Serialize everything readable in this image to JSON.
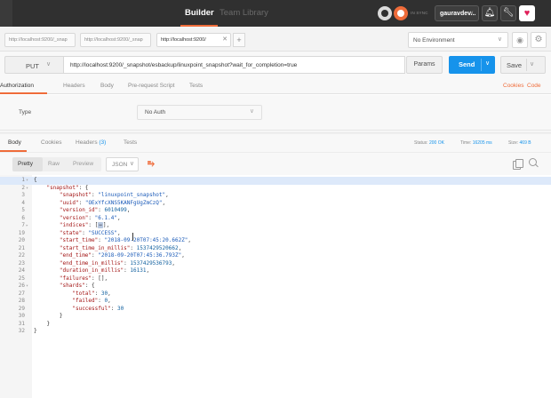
{
  "topbar": {
    "builder_label": "Builder",
    "team_label": "Team Library",
    "sync_label": "IN SYNC",
    "user_label": "gauravdev...",
    "accent": "#ef6c3a"
  },
  "request_tabs": [
    {
      "label": "http://localhost:9200/_snap"
    },
    {
      "label": "http://localhost:9200/_snap"
    },
    {
      "label": "http://localhost:9200/"
    }
  ],
  "environment": {
    "selected": "No Environment"
  },
  "request": {
    "method": "PUT",
    "url": "http://localhost:9200/_snapshot/esbackup/linuxpoint_snapshot?wait_for_completion=true",
    "params_label": "Params",
    "send_label": "Send",
    "save_label": "Save",
    "send_color": "#1693eb"
  },
  "request_subtabs": {
    "items": [
      "Authorization",
      "Headers",
      "Body",
      "Pre-request Script",
      "Tests"
    ],
    "active": "Authorization",
    "links": [
      "Cookies",
      "Code"
    ]
  },
  "auth": {
    "type_label": "Type",
    "type_value": "No Auth"
  },
  "response_tabs": {
    "body": "Body",
    "cookies": "Cookies",
    "headers": "Headers",
    "headers_count": "(3)",
    "tests": "Tests"
  },
  "response_status": {
    "status_label": "Status:",
    "status_value": "200 OK",
    "time_label": "Time:",
    "time_value": "16205 ms",
    "size_label": "Size:",
    "size_value": "469 B"
  },
  "view_options": {
    "pretty": "Pretty",
    "raw": "Raw",
    "preview": "Preview",
    "format": "JSON"
  },
  "code_lines": [
    {
      "n": "1",
      "fold": "▾",
      "html": "{"
    },
    {
      "n": "2",
      "fold": "▾",
      "html": "    <span class='k'>\"snapshot\"</span>: {"
    },
    {
      "n": "3",
      "fold": "",
      "html": "        <span class='k'>\"snapshot\"</span>: <span class='s'>\"linuxpoint_snapshot\"</span>,"
    },
    {
      "n": "4",
      "fold": "",
      "html": "        <span class='k'>\"uuid\"</span>: <span class='s'>\"OExYfcXNS5KANFgUgZmCzQ\"</span>,"
    },
    {
      "n": "5",
      "fold": "",
      "html": "        <span class='k'>\"version_id\"</span>: <span class='n'>6010499</span>,"
    },
    {
      "n": "6",
      "fold": "",
      "html": "        <span class='k'>\"version\"</span>: <span class='s'>\"6.1.4\"</span>,"
    },
    {
      "n": "7",
      "fold": "▸",
      "html": "        <span class='k'>\"indices\"</span>: [<span class='fold-marker'>↔</span>],"
    },
    {
      "n": "19",
      "fold": "",
      "html": "        <span class='k'>\"state\"</span>: <span class='s'>\"SUCCESS\"</span>,"
    },
    {
      "n": "20",
      "fold": "",
      "html": "        <span class='k'>\"start_time\"</span>: <span class='s'>\"2018-09-20T07:45:20.662Z\"</span>,"
    },
    {
      "n": "21",
      "fold": "",
      "html": "        <span class='k'>\"start_time_in_millis\"</span>: <span class='n'>1537429520662</span>,"
    },
    {
      "n": "22",
      "fold": "",
      "html": "        <span class='k'>\"end_time\"</span>: <span class='s'>\"2018-09-20T07:45:36.793Z\"</span>,"
    },
    {
      "n": "23",
      "fold": "",
      "html": "        <span class='k'>\"end_time_in_millis\"</span>: <span class='n'>1537429536793</span>,"
    },
    {
      "n": "24",
      "fold": "",
      "html": "        <span class='k'>\"duration_in_millis\"</span>: <span class='n'>16131</span>,"
    },
    {
      "n": "25",
      "fold": "",
      "html": "        <span class='k'>\"failures\"</span>: [],"
    },
    {
      "n": "26",
      "fold": "▾",
      "html": "        <span class='k'>\"shards\"</span>: {"
    },
    {
      "n": "27",
      "fold": "",
      "html": "            <span class='k'>\"total\"</span>: <span class='n'>30</span>,"
    },
    {
      "n": "28",
      "fold": "",
      "html": "            <span class='k'>\"failed\"</span>: <span class='n'>0</span>,"
    },
    {
      "n": "29",
      "fold": "",
      "html": "            <span class='k'>\"successful\"</span>: <span class='n'>30</span>"
    },
    {
      "n": "30",
      "fold": "",
      "html": "        }"
    },
    {
      "n": "31",
      "fold": "",
      "html": "    }"
    },
    {
      "n": "32",
      "fold": "",
      "html": "}"
    }
  ]
}
